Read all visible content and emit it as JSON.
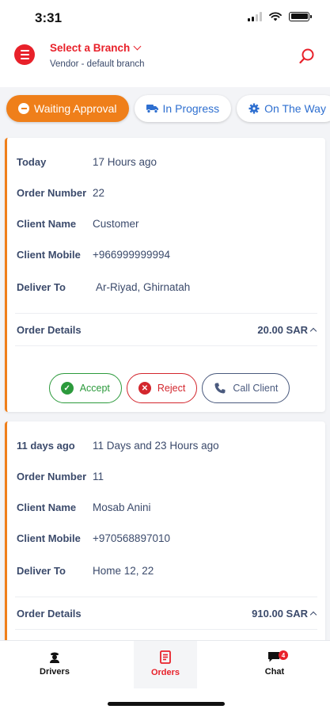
{
  "status": {
    "time": "3:31"
  },
  "header": {
    "branch_title": "Select a Branch",
    "branch_subtitle": "Vendor - default branch"
  },
  "tabs": [
    {
      "label": "Waiting Approval",
      "active": true
    },
    {
      "label": "In Progress",
      "active": false
    },
    {
      "label": "On The Way",
      "active": false
    }
  ],
  "orders": [
    {
      "date_label": "Today",
      "date_value": "17 Hours ago",
      "order_number_label": "Order Number",
      "order_number": "22",
      "client_name_label": "Client Name",
      "client_name": "Customer",
      "client_mobile_label": "Client Mobile",
      "client_mobile": "+966999999994",
      "deliver_to_label": "Deliver To",
      "deliver_to": "Ar-Riyad, Ghirnatah",
      "details_label": "Order Details",
      "total": "20.00 SAR",
      "actions": {
        "accept": "Accept",
        "reject": "Reject",
        "call": "Call Client"
      }
    },
    {
      "date_label": "11 days ago",
      "date_value": "11 Days and 23 Hours ago",
      "order_number_label": "Order Number",
      "order_number": "11",
      "client_name_label": "Client Name",
      "client_name": "Mosab Anini",
      "client_mobile_label": "Client Mobile",
      "client_mobile": "+970568897010",
      "deliver_to_label": "Deliver To",
      "deliver_to": "Home 12, 22",
      "details_label": "Order Details",
      "total": "910.00 SAR"
    }
  ],
  "bottom_nav": [
    {
      "label": "Drivers",
      "icon": "driver-icon",
      "active": false
    },
    {
      "label": "Orders",
      "icon": "orders-icon",
      "active": true
    },
    {
      "label": "Chat",
      "icon": "chat-icon",
      "active": false,
      "badge": "4"
    }
  ],
  "colors": {
    "brand_red": "#e8212a",
    "accent_orange": "#ef7f1a",
    "tab_blue": "#2e6fd0",
    "accept_green": "#2c9a3c"
  }
}
